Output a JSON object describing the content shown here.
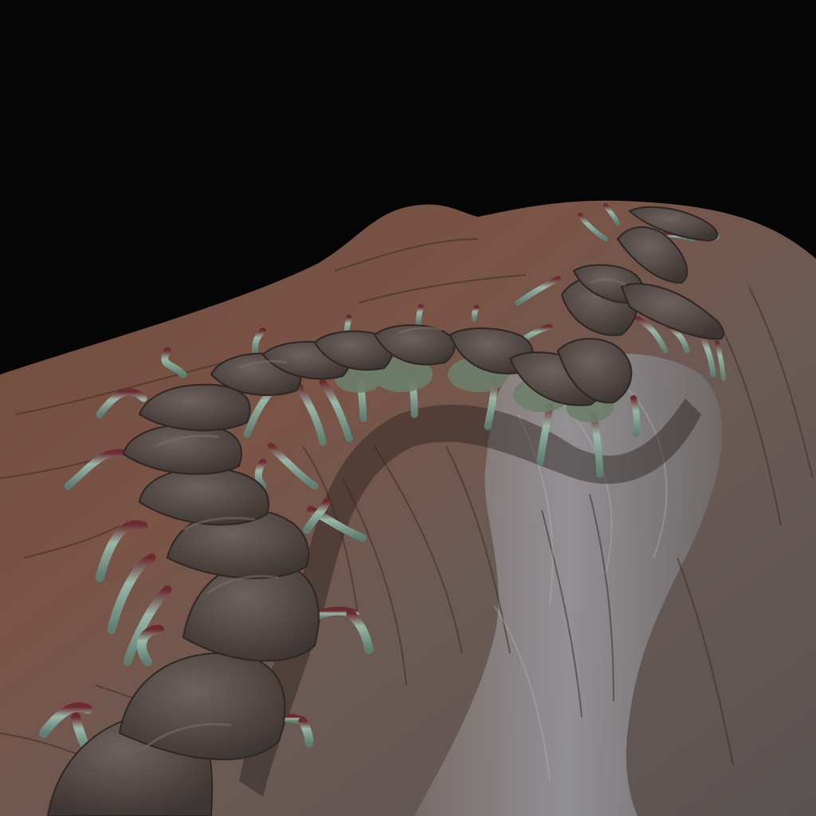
{
  "scene": {
    "subject": "centipede",
    "surface": "log",
    "colors": {
      "background": "#050505",
      "bark_warm": "#7a5445",
      "bark_dark": "#4a3a33",
      "bark_pale": "#8d8c8e",
      "body_plate": "#4a4240",
      "body_plate_light": "#6b5f5a",
      "leg_pale": "#8fb0a0",
      "leg_joint": "#6b2a30",
      "underside": "#6d7f6c"
    }
  }
}
